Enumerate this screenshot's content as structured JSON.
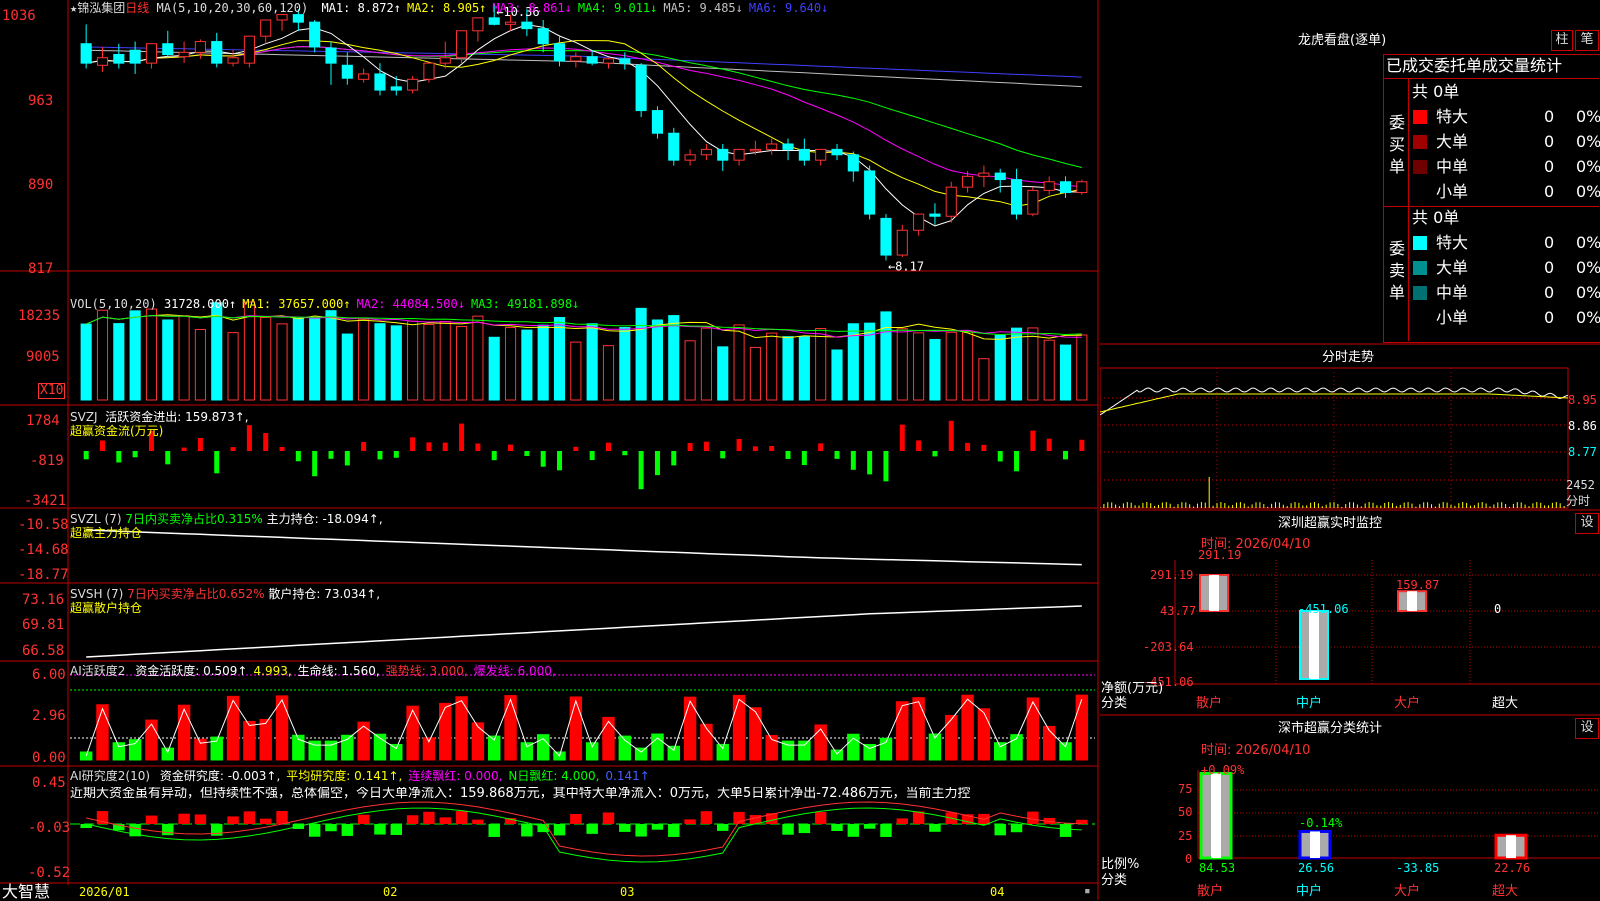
{
  "kline": {
    "stock_name": "锦泓集团",
    "star": "★",
    "period": "日线",
    "ma_label": "MA(5,10,20,30,60,120)",
    "ma_items": [
      {
        "text": "MA1: 8.872↑",
        "color": "#ffffff"
      },
      {
        "text": "MA2: 8.905↑",
        "color": "#ffff00"
      },
      {
        "text": "MA3: 8.861↓",
        "color": "#ff00ff"
      },
      {
        "text": "MA4: 9.011↓",
        "color": "#00ff00"
      },
      {
        "text": "MA5: 9.485↓",
        "color": "#c0c0c0"
      },
      {
        "text": "MA6: 9.640↓",
        "color": "#4040ff"
      }
    ],
    "y_ticks": [
      "1036",
      "963",
      "890",
      "817"
    ],
    "high_mark": "10.36",
    "low_mark": "8.17",
    "candles": [
      [
        10.18,
        10.36,
        10.0,
        9.95
      ],
      [
        9.98,
        10.15,
        10.05,
        9.92
      ],
      [
        10.08,
        10.18,
        10.0,
        9.95
      ],
      [
        10.12,
        10.2,
        10.0,
        9.9
      ],
      [
        10.0,
        10.18,
        10.18,
        9.95
      ],
      [
        10.18,
        10.3,
        10.08,
        10.05
      ],
      [
        10.06,
        10.2,
        10.1,
        10.0
      ],
      [
        10.1,
        10.22,
        10.2,
        10.04
      ],
      [
        10.2,
        10.28,
        10.0,
        9.96
      ],
      [
        10.0,
        10.12,
        10.05,
        9.97
      ],
      [
        10.0,
        10.15,
        10.25,
        9.96
      ],
      [
        10.25,
        10.38,
        10.4,
        10.18
      ],
      [
        10.4,
        10.45,
        10.45,
        10.3
      ],
      [
        10.45,
        10.5,
        10.38,
        10.3
      ],
      [
        10.38,
        10.4,
        10.15,
        10.1
      ],
      [
        10.14,
        10.2,
        10.0,
        9.8
      ],
      [
        9.98,
        10.1,
        9.86,
        9.8
      ],
      [
        9.85,
        9.95,
        9.9,
        9.82
      ],
      [
        9.9,
        10.0,
        9.75,
        9.7
      ],
      [
        9.78,
        9.88,
        9.75,
        9.7
      ],
      [
        9.75,
        9.88,
        9.85,
        9.72
      ],
      [
        9.85,
        9.95,
        10.0,
        9.82
      ],
      [
        10.0,
        10.2,
        10.05,
        9.95
      ],
      [
        10.05,
        10.25,
        10.3,
        10.0
      ],
      [
        10.3,
        10.4,
        10.42,
        10.2
      ],
      [
        10.42,
        10.55,
        10.36,
        10.35
      ],
      [
        10.36,
        10.45,
        10.38,
        10.3
      ],
      [
        10.38,
        10.5,
        10.32,
        10.25
      ],
      [
        10.32,
        10.4,
        10.18,
        10.1
      ],
      [
        10.18,
        10.26,
        10.02,
        9.97
      ],
      [
        10.02,
        10.1,
        10.06,
        9.96
      ],
      [
        10.06,
        10.12,
        10.0,
        9.98
      ],
      [
        10.0,
        10.05,
        10.04,
        9.95
      ],
      [
        10.04,
        10.1,
        10.0,
        9.94
      ],
      [
        9.98,
        10.0,
        9.56,
        9.5
      ],
      [
        9.56,
        9.6,
        9.35,
        9.3
      ],
      [
        9.35,
        9.4,
        9.1,
        9.05
      ],
      [
        9.1,
        9.2,
        9.15,
        9.05
      ],
      [
        9.15,
        9.25,
        9.2,
        9.1
      ],
      [
        9.2,
        9.25,
        9.1,
        9.0
      ],
      [
        9.1,
        9.2,
        9.2,
        9.05
      ],
      [
        9.2,
        9.28,
        9.2,
        9.15
      ],
      [
        9.2,
        9.3,
        9.25,
        9.15
      ],
      [
        9.25,
        9.3,
        9.2,
        9.1
      ],
      [
        9.2,
        9.3,
        9.1,
        9.05
      ],
      [
        9.1,
        9.2,
        9.2,
        9.05
      ],
      [
        9.2,
        9.25,
        9.15,
        9.1
      ],
      [
        9.15,
        9.18,
        9.0,
        8.9
      ],
      [
        9.0,
        9.05,
        8.6,
        8.55
      ],
      [
        8.56,
        8.6,
        8.22,
        8.17
      ],
      [
        8.22,
        8.5,
        8.45,
        8.2
      ],
      [
        8.45,
        8.55,
        8.6,
        8.4
      ],
      [
        8.6,
        8.7,
        8.58,
        8.5
      ],
      [
        8.58,
        8.9,
        8.85,
        8.52
      ],
      [
        8.85,
        9.0,
        8.95,
        8.8
      ],
      [
        8.95,
        9.05,
        8.98,
        8.85
      ],
      [
        8.98,
        9.02,
        8.92,
        8.8
      ],
      [
        8.92,
        9.02,
        8.6,
        8.55
      ],
      [
        8.6,
        8.85,
        8.82,
        8.58
      ],
      [
        8.82,
        8.95,
        8.9,
        8.78
      ],
      [
        8.9,
        8.95,
        8.8,
        8.75
      ],
      [
        8.8,
        8.92,
        8.9,
        8.78
      ]
    ]
  },
  "vol": {
    "label": "VOL(5,10,20)",
    "value": "31728.000↑",
    "ma_items": [
      {
        "text": "MA1: 37657.000↑",
        "color": "#ffff00"
      },
      {
        "text": "MA2: 44084.500↓",
        "color": "#ff00ff"
      },
      {
        "text": "MA3: 49181.898↓",
        "color": "#00ff00"
      }
    ],
    "y_ticks": [
      "18235",
      "9005"
    ],
    "unit": "X10"
  },
  "svzj": {
    "label": "SVZJ",
    "line1": "活跃资金进出: 159.873↑,",
    "line2": "超赢资金流(万元)",
    "y_ticks": [
      "1784",
      "-819",
      "-3421"
    ]
  },
  "svzl": {
    "label": "SVZL (7)",
    "text1": "7日内买卖净占比0.315%",
    "text2": "主力持仓: -18.094↑,",
    "line2": "超赢主力持仓",
    "y_ticks": [
      "-10.58",
      "-14.68",
      "-18.77"
    ]
  },
  "svsh": {
    "label": "SVSH (7)",
    "text1": "7日内买卖净占比0.652%",
    "text2": "散户持仓: 73.034↑,",
    "line2": "超赢散户持仓",
    "y_ticks": [
      "73.16",
      "69.81",
      "66.58"
    ]
  },
  "ai1": {
    "label": "AI活跃度2",
    "items": [
      {
        "text": "资金活跃度: 0.509↑",
        "color": "#ffffff"
      },
      {
        "text": "4.993,",
        "color": "#ffff00"
      },
      {
        "text": "生命线: 1.560,",
        "color": "#ffffff"
      },
      {
        "text": "强势线: 3.000,",
        "color": "#ff3030"
      },
      {
        "text": "爆发线: 6.000,",
        "color": "#ff00ff"
      }
    ],
    "y_ticks": [
      "6.00",
      "2.96",
      "0.00"
    ]
  },
  "ai2": {
    "label": "AI研究度2(10)",
    "items": [
      {
        "text": "资金研究度: -0.003↑,",
        "color": "#ffffff"
      },
      {
        "text": "平均研究度: 0.141↑,",
        "color": "#ffff00"
      },
      {
        "text": "连续飘红: 0.000,",
        "color": "#ff00ff"
      },
      {
        "text": "N日飘红: 4.000,",
        "color": "#00ff00"
      },
      {
        "text": "0.141↑",
        "color": "#4060ff"
      }
    ],
    "note": "近期大资金虽有异动，但持续性不强，总体偏空，今日大单净流入：159.868万元，其中特大单净流入：0万元，大单5日累计净出-72.486万元，当前主力控",
    "y_ticks": [
      "0.45",
      "-0.03",
      "-0.52"
    ]
  },
  "bottom": {
    "brand": "大智慧",
    "months": [
      "2026/01",
      "02",
      "03",
      "04"
    ]
  },
  "lhb": {
    "title": "龙虎看盘(逐单)",
    "btn_col": "柱",
    "btn_tick": "笔",
    "header": "已成交委托单成交量统计",
    "buy_label": [
      "委",
      "买",
      "单"
    ],
    "sell_label": [
      "委",
      "卖",
      "单"
    ],
    "buy_total": "共 0单",
    "sell_total": "共 0单",
    "buy_rows": [
      {
        "name": "特大",
        "color": "#ff0000",
        "count": "0",
        "pct": "0%"
      },
      {
        "name": "大单",
        "color": "#a00000",
        "count": "0",
        "pct": "0%"
      },
      {
        "name": "中单",
        "color": "#700000",
        "count": "0",
        "pct": "0%"
      },
      {
        "name": "小单",
        "color": "",
        "count": "0",
        "pct": "0%"
      }
    ],
    "sell_rows": [
      {
        "name": "特大",
        "color": "#00ffff",
        "count": "0",
        "pct": "0%"
      },
      {
        "name": "大单",
        "color": "#009090",
        "count": "0",
        "pct": "0%"
      },
      {
        "name": "中单",
        "color": "#007070",
        "count": "0",
        "pct": "0%"
      },
      {
        "name": "小单",
        "color": "",
        "count": "0",
        "pct": "0%"
      }
    ]
  },
  "fenshi": {
    "title": "分时走势",
    "y_ticks": [
      "8.95",
      "8.86",
      "8.77"
    ],
    "vol_tick": "2452",
    "unit": "分时"
  },
  "sz_monitor": {
    "title": "深圳超赢实时监控",
    "btn": "设",
    "time": "时间: 2026/04/10",
    "y_ticks": [
      "291.19",
      "43.77",
      "-203.64",
      "-451.06"
    ],
    "y_label1": "净额(万元)",
    "y_label2": "分类",
    "categories": [
      "散户",
      "中户",
      "大户",
      "超大"
    ],
    "values": [
      291.19,
      -451.06,
      159.87,
      0
    ],
    "value_labels": [
      "291.19",
      "-451.06",
      "159.87",
      "0"
    ]
  },
  "sz_category": {
    "title": "深市超赢分类统计",
    "btn": "设",
    "time": "时间: 2026/04/10",
    "y_ticks": [
      "75",
      "50",
      "25",
      "0"
    ],
    "y_label1": "比例%",
    "y_label2": "分类",
    "categories": [
      "散户",
      "中户",
      "大户",
      "超大"
    ],
    "top_labels": [
      "+0.09%",
      "-0.14%"
    ],
    "values": [
      84.53,
      26.56,
      -33.85,
      22.76
    ],
    "value_labels": [
      "84.53",
      "26.56",
      "-33.85",
      "22.76"
    ]
  },
  "colors": {
    "border": "#c00000",
    "up": "#ff3232",
    "down": "#00ffff",
    "axis_text": "#ff3232"
  }
}
